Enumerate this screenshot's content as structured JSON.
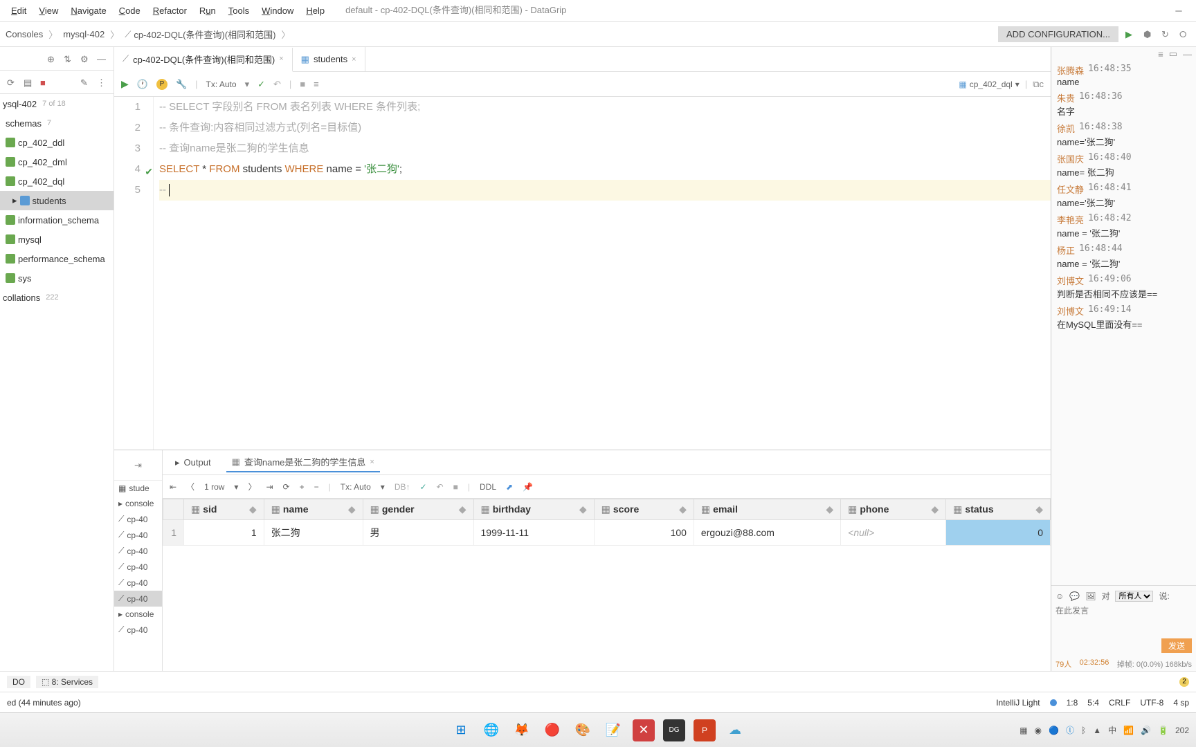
{
  "menu": {
    "edit": "Edit",
    "view": "View",
    "navigate": "Navigate",
    "code": "Code",
    "refactor": "Refactor",
    "run": "Run",
    "tools": "Tools",
    "window": "Window",
    "help": "Help"
  },
  "title": "default - cp-402-DQL(条件查询)(相同和范围) - DataGrip",
  "breadcrumb": {
    "a": "Consoles",
    "b": "mysql-402",
    "c": "cp-402-DQL(条件查询)(相同和范围)"
  },
  "addConfig": "ADD CONFIGURATION...",
  "tree": {
    "root": "ysql-402",
    "rootBadge": "7 of 18",
    "schemas": "schemas",
    "schemasBadge": "7",
    "ddl": "cp_402_ddl",
    "dml": "cp_402_dml",
    "dql": "cp_402_dql",
    "students": "students",
    "info": "information_schema",
    "mysql": "mysql",
    "perf": "performance_schema",
    "sys": "sys",
    "coll": "collations",
    "collBadge": "222"
  },
  "sideList": {
    "stud": "stude",
    "cons": "console",
    "cp1": "cp-40",
    "cp2": "cp-40",
    "cp3": "cp-40",
    "cp4": "cp-40",
    "cp5": "cp-40",
    "cp6": "cp-40",
    "cons2": "console",
    "cp7": "cp-40"
  },
  "tabs": {
    "t1": "cp-402-DQL(条件查询)(相同和范围)",
    "t2": "students"
  },
  "toolbar": {
    "tx": "Tx: Auto",
    "db": "cp_402_dql"
  },
  "code": {
    "l1": "-- SELECT 字段别名 FROM 表名列表 WHERE 条件列表;",
    "l2": "-- 条件查询:内容相同过滤方式(列名=目标值)",
    "l3": "-- 查询name是张二狗的学生信息",
    "l4_select": "SELECT",
    "l4_star": " * ",
    "l4_from": "FROM",
    "l4_tbl": " students ",
    "l4_where": "WHERE",
    "l4_col": " name = ",
    "l4_str": "'张二狗'",
    "l4_end": ";",
    "l5": "-- "
  },
  "resultTabs": {
    "output": "Output",
    "query": "查询name是张二狗的学生信息"
  },
  "resultToolbar": {
    "rows": "1 row",
    "tx": "Tx: Auto",
    "ddl": "DDL"
  },
  "columns": {
    "sid": "sid",
    "name": "name",
    "gender": "gender",
    "birthday": "birthday",
    "score": "score",
    "email": "email",
    "phone": "phone",
    "status": "status"
  },
  "row": {
    "n": "1",
    "sid": "1",
    "name": "张二狗",
    "gender": "男",
    "birthday": "1999-11-11",
    "score": "100",
    "email": "ergouzi@88.com",
    "phone": "<null>",
    "status": "0"
  },
  "chart_data": {
    "type": "table",
    "columns": [
      "sid",
      "name",
      "gender",
      "birthday",
      "score",
      "email",
      "phone",
      "status"
    ],
    "rows": [
      [
        1,
        "张二狗",
        "男",
        "1999-11-11",
        100,
        "ergouzi@88.com",
        null,
        0
      ]
    ]
  },
  "chat": {
    "msgs": [
      {
        "name": "张腾森",
        "time": "16:48:35",
        "text": "name"
      },
      {
        "name": "朱贵",
        "time": "16:48:36",
        "text": "名字"
      },
      {
        "name": "徐凯",
        "time": "16:48:38",
        "text": "name='张二狗'"
      },
      {
        "name": "张国庆",
        "time": "16:48:40",
        "text": "name=  张二狗"
      },
      {
        "name": "任文静",
        "time": "16:48:41",
        "text": "name='张二狗'"
      },
      {
        "name": "李艳亮",
        "time": "16:48:42",
        "text": "name  =  '张二狗'"
      },
      {
        "name": "杨正",
        "time": "16:48:44",
        "text": "name  =  '张二狗'"
      },
      {
        "name": "刘博文",
        "time": "16:49:06",
        "text": "判断是否相同不应该是=="
      },
      {
        "name": "刘博文",
        "time": "16:49:14",
        "text": "在MySQL里面没有=="
      }
    ],
    "target": "对",
    "all": "所有人",
    "say": "说:",
    "placeholder": "在此发言",
    "send": "发送",
    "people": "79人",
    "ctime": "02:32:56",
    "drop": "掉帧:",
    "rate": "0(0.0%) 168kb/s"
  },
  "status": {
    "todo": "DO",
    "services": "8: Services",
    "msg": "ed (44 minutes ago)",
    "theme": "IntelliJ Light",
    "pos": "1:8",
    "col": "5:4",
    "crlf": "CRLF",
    "enc": "UTF-8",
    "sp": "4 sp",
    "warn": "2"
  },
  "tray": {
    "year": "202"
  }
}
